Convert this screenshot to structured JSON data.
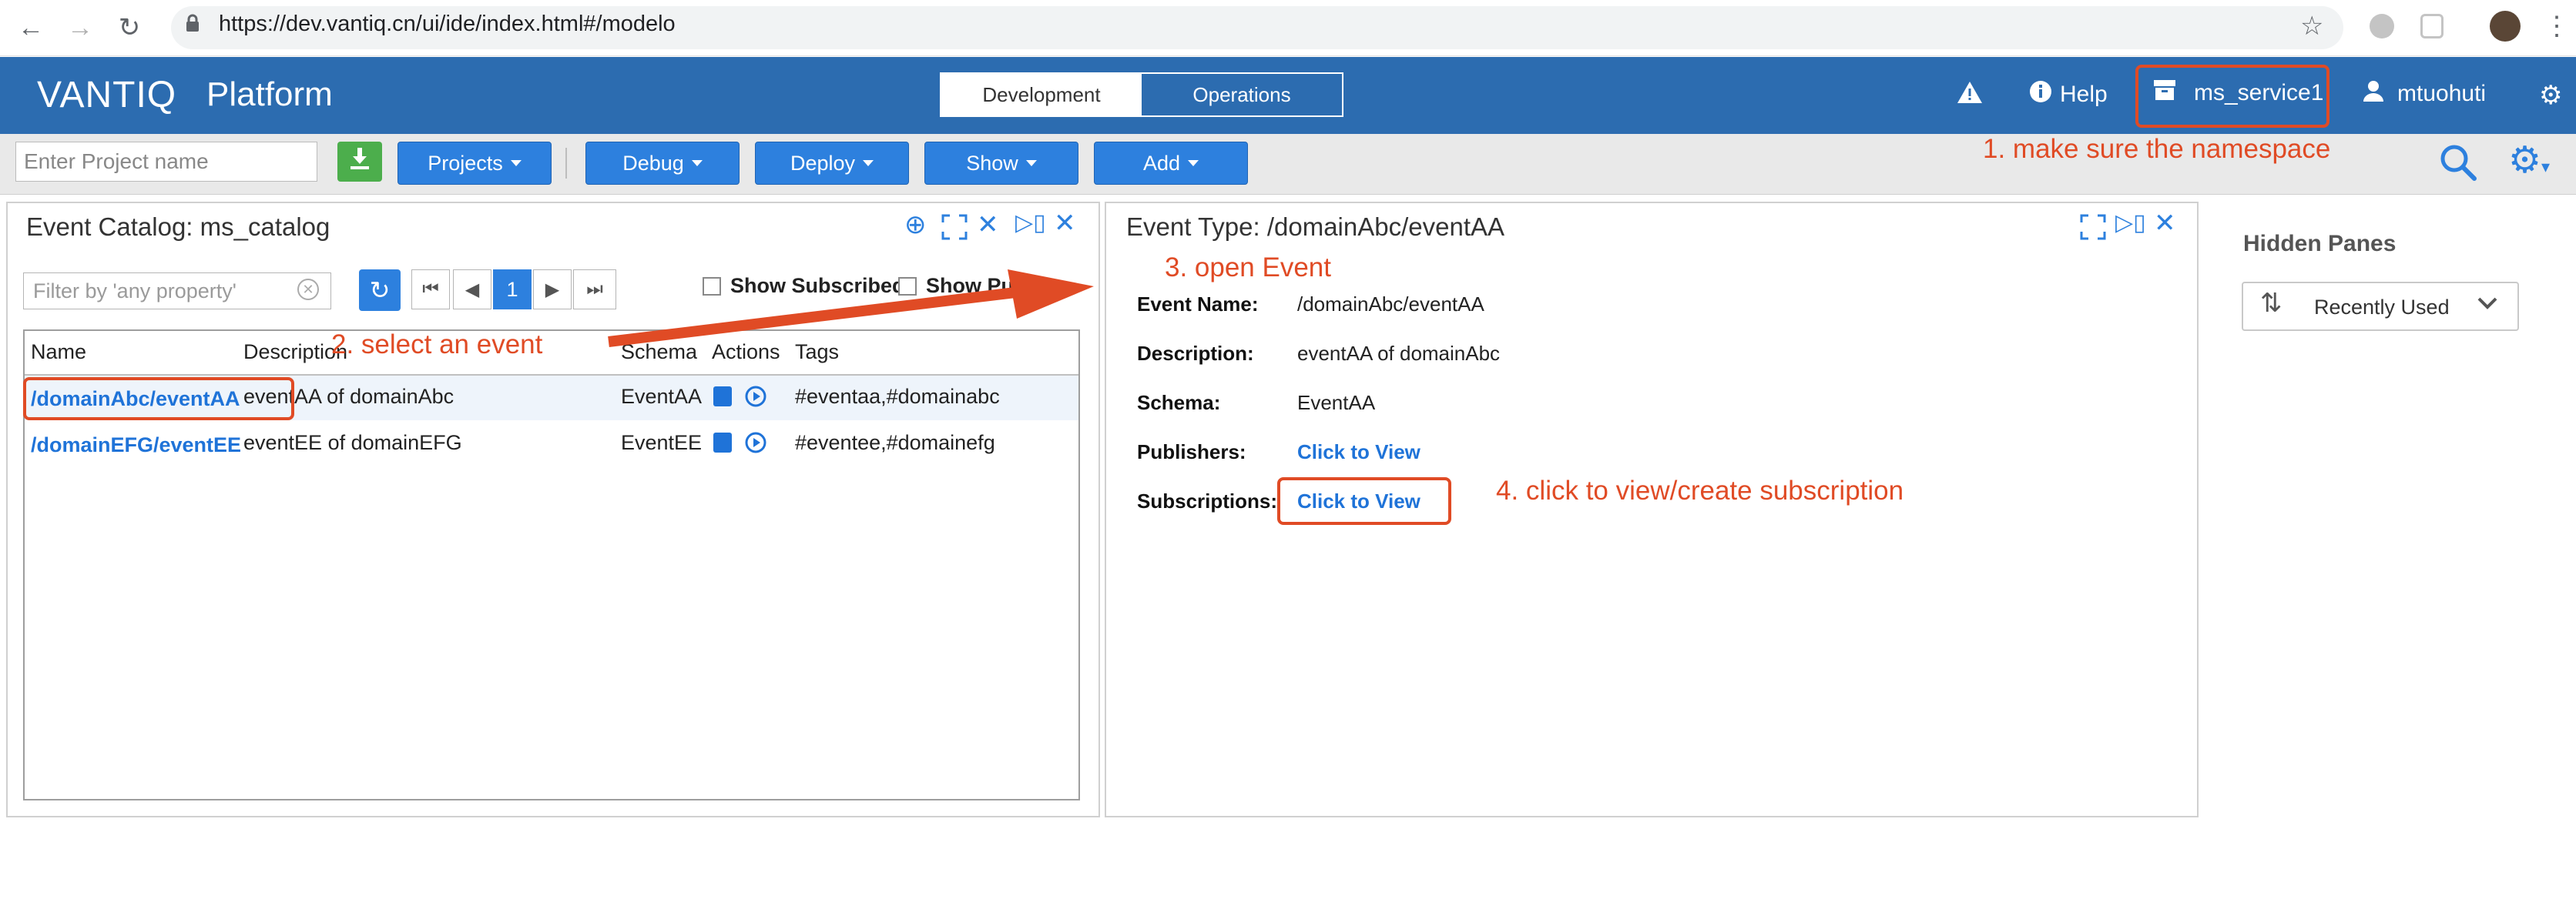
{
  "browser": {
    "url": "https://dev.vantiq.cn/ui/ide/index.html#/modelo"
  },
  "header": {
    "logo": "VANTIQ",
    "product": "Platform",
    "tabs": [
      "Development",
      "Operations"
    ],
    "help_label": "Help",
    "namespace": "ms_service1",
    "user": "mtuohuti"
  },
  "toolbar": {
    "project_placeholder": "Enter Project name",
    "buttons": [
      "Projects",
      "Debug",
      "Deploy",
      "Show",
      "Add"
    ]
  },
  "catalog": {
    "title": "Event Catalog: ms_catalog",
    "filter_placeholder": "Filter by 'any property'",
    "page": "1",
    "show_subscribed": "Show Subscribed",
    "show_published": "Show Publi",
    "columns": [
      "Name",
      "Description",
      "Schema",
      "Actions",
      "Tags"
    ],
    "rows": [
      {
        "name": "/domainAbc/eventAA",
        "description": "eventAA of domainAbc",
        "schema": "EventAA",
        "tags": "#eventaa,#domainabc"
      },
      {
        "name": "/domainEFG/eventEE",
        "description": "eventEE of domainEFG",
        "schema": "EventEE",
        "tags": "#eventee,#domainefg"
      }
    ]
  },
  "detail": {
    "title": "Event Type: /domainAbc/eventAA",
    "fields": [
      {
        "label": "Event Name:",
        "value": "/domainAbc/eventAA"
      },
      {
        "label": "Description:",
        "value": "eventAA of domainAbc"
      },
      {
        "label": "Schema:",
        "value": "EventAA"
      },
      {
        "label": "Publishers:",
        "value": "Click to View"
      },
      {
        "label": "Subscriptions:",
        "value": "Click to View"
      }
    ]
  },
  "hidden_panes": {
    "title": "Hidden Panes",
    "selected": "Recently Used"
  },
  "annotations": {
    "step1": "1. make sure the namespace",
    "step2": "2. select an event",
    "step3": "3. open Event",
    "step4": "4. click to view/create subscription"
  },
  "colors": {
    "header_blue": "#2c6cb0",
    "button_blue": "#2d80de",
    "link_blue": "#1f73d8",
    "download_green": "#4cae4c",
    "annotation_red": "#e04b25"
  }
}
